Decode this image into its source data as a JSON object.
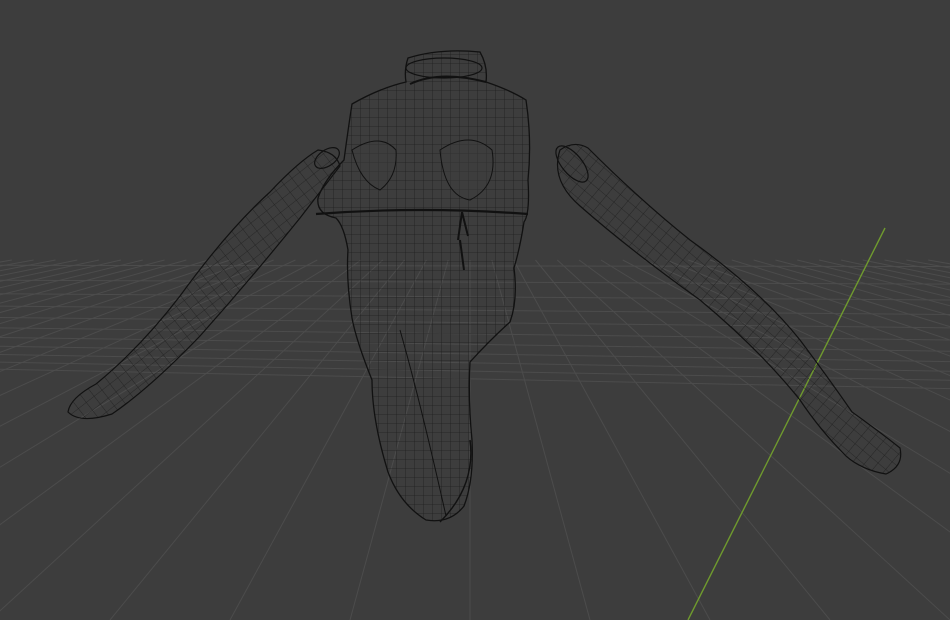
{
  "viewport": {
    "mode": "wireframe",
    "background_color": "#3d3d3d",
    "grid_line_color": "#4c4c4c",
    "y_axis_color": "#6f9a2e",
    "wire_color": "#1f1f1f",
    "wire_edge_color": "#101010",
    "grid_visible": true
  },
  "scene": {
    "objects": [
      {
        "name": "garment-torso",
        "type": "mesh",
        "display": "wireframe"
      },
      {
        "name": "garment-left-sleeve",
        "type": "mesh",
        "display": "wireframe"
      },
      {
        "name": "garment-right-sleeve",
        "type": "mesh",
        "display": "wireframe"
      }
    ]
  }
}
